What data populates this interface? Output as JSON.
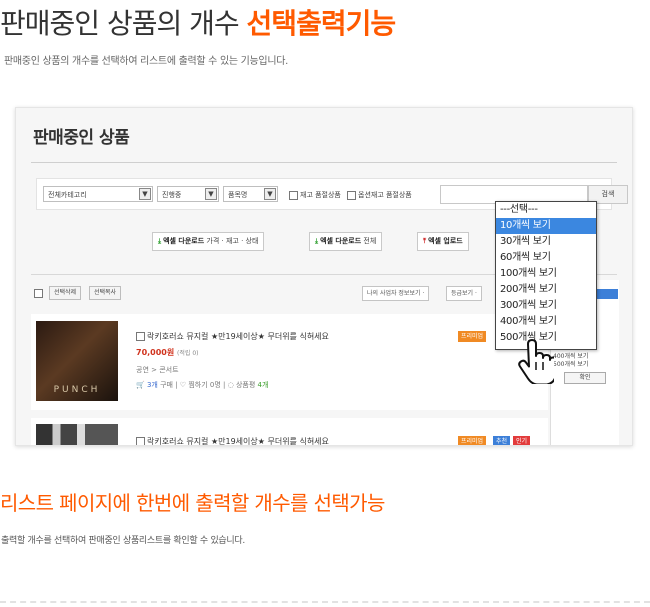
{
  "hero": {
    "title_plain": "판매중인 상품의 개수 ",
    "title_accent": "선택출력기능",
    "subtitle": "판매중인 상품의 개수를 선택하여 리스트에 출력할 수 있는 기능입니다."
  },
  "shot": {
    "page_title": "판매중인 상품",
    "filters": {
      "category": "전체카테고리",
      "status": "진행중",
      "field": "품목명",
      "stock_soldout": "재고 품절상품",
      "option_soldout": "옵션재고 품절상품",
      "search_label": "검색"
    },
    "excel": {
      "download1_bold": "엑셀 다운로드",
      "download1_rest": " 가격 · 재고 · 상태",
      "download2_bold": "엑셀 다운로드",
      "download2_rest": " 전체",
      "upload": "엑셀 업로드"
    },
    "list_toolbar": {
      "delete": "선택삭제",
      "copy": "선택복사",
      "sort1": "나의 사업자 정보보기 ·",
      "sort2": "등급보기 ·"
    },
    "dropdown": {
      "options": [
        "---선택---",
        "10개씩 보기",
        "30개씩 보기",
        "60개씩 보기",
        "100개씩 보기",
        "200개씩 보기",
        "300개씩 보기",
        "400개씩 보기",
        "500개씩 보기"
      ],
      "selected_index": 1,
      "selected_color": "#3b87e0"
    },
    "side": {
      "line1": "400개씩 보기",
      "line2": "500개씩 보기",
      "button": "확인"
    },
    "items": [
      {
        "name": "락키호러쇼 뮤지컬 ★만19세이상★ 무더위를 식혀세요",
        "price": "70,000원",
        "points": "(적립 0)",
        "category": "공연 > 콘서트",
        "buy_count": "3개",
        "buy_label": "구매",
        "wish_label": "찜하기",
        "wish_count": "0명",
        "review_label": "상품평",
        "review_count": "4개",
        "badge": "프리미엄",
        "thumb_text": "PUNCH"
      },
      {
        "name": "락키호러쇼 뮤지컬 ★만19세이상★ 무더위를 식혀세요",
        "badges": [
          "프리미엄",
          "추천",
          "인기"
        ]
      }
    ]
  },
  "section": {
    "title": "리스트 페이지에 한번에 출력할 개수를 선택가능",
    "subtitle": "출력할 개수를 선택하여 판매중인 상품리스트를 확인할 수 있습니다."
  },
  "colors": {
    "accent": "#ff5a00",
    "price": "#d0331e",
    "selection": "#3b87e0"
  }
}
